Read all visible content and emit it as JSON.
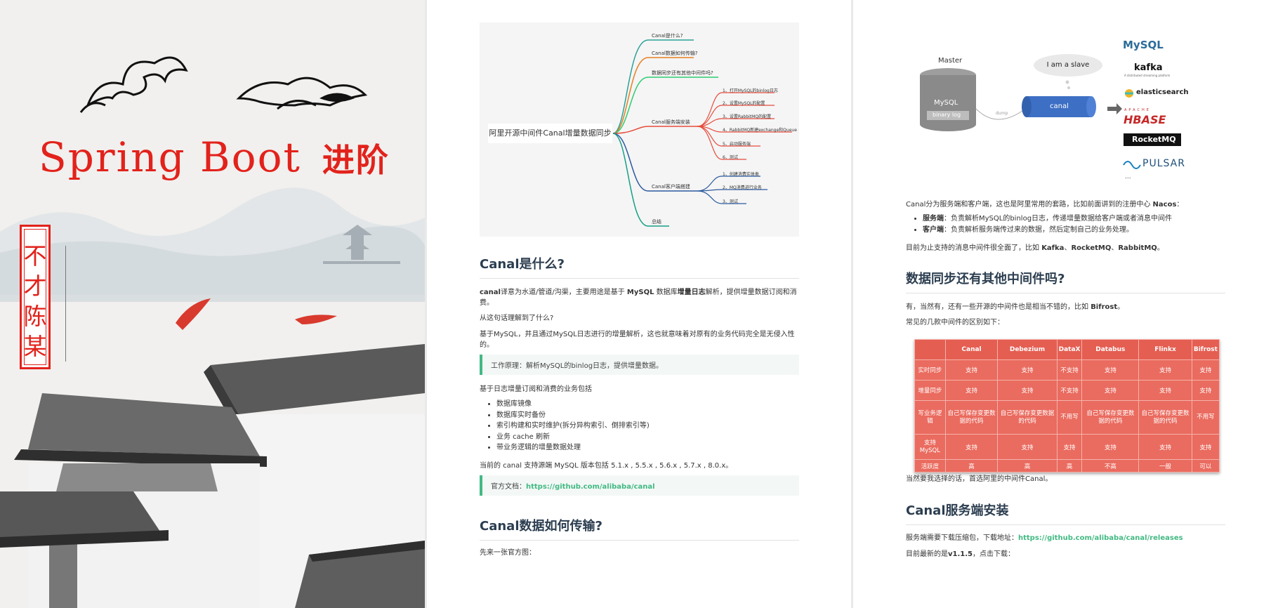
{
  "cover": {
    "title": "Spring Boot",
    "title_suffix": "进阶",
    "seal_text": [
      "不",
      "才",
      "陈",
      "某"
    ]
  },
  "page2": {
    "mindmap": {
      "root": "阿里开源中间件Canal增量数据同步",
      "branches": [
        {
          "label": "Canal是什么?",
          "color": "#2aa198",
          "children": []
        },
        {
          "label": "Canal数据如何传输?",
          "color": "#e67e22",
          "children": []
        },
        {
          "label": "数据同步还有其他中间件吗?",
          "color": "#2ecc71",
          "children": []
        },
        {
          "label": "Canal服务端安装",
          "color": "#e74c3c",
          "children": [
            "1、打开MySQL的binlog日志",
            "2、设置MySQL的配置",
            "3、设置RabbitMQ的配置",
            "4、RabbitMQ新建exchange和Queue",
            "5、启动服务端",
            "6、测试"
          ]
        },
        {
          "label": "Canal客户端搭建",
          "color": "#2c5aa0",
          "children": [
            "1、创建消费实体类",
            "2、MQ消费进行业务",
            "3、测试"
          ]
        },
        {
          "label": "总结",
          "color": "#16a085",
          "children": []
        }
      ]
    },
    "sec1_title": "Canal是什么?",
    "sec1_p1_a": "canal",
    "sec1_p1_b": "译意为水道/管道/沟渠，主要用途是基于 ",
    "sec1_p1_c": "MySQL",
    "sec1_p1_d": " 数据库",
    "sec1_p1_e": "增量日志",
    "sec1_p1_f": "解析，提供增量数据订阅和消",
    "sec1_p1_g": "费。",
    "sec1_p2": "从这句话理解到了什么?",
    "sec1_p3a": "基于MySQL，并且通过MySQL日志进行的增量解析，这也就意味着对原有的业务代码完全是无侵入性",
    "sec1_p3b": "的。",
    "callout1": "工作原理：解析MySQL的binlog日志，提供增量数据。",
    "sec1_p4": "基于日志增量订阅和消费的业务包括",
    "bullets": [
      "数据库镜像",
      "数据库实时备份",
      "索引构建和实时维护(拆分异构索引、倒排索引等)",
      "业务 cache 刷新",
      "带业务逻辑的增量数据处理"
    ],
    "sec1_p5": "当前的 canal 支持源端 MySQL 版本包括 5.1.x , 5.5.x , 5.6.x , 5.7.x , 8.0.x。",
    "callout2_label": "官方文档：",
    "callout2_link": "https://github.com/alibaba/canal",
    "sec2_title": "Canal数据如何传输?",
    "sec2_p1": "先来一张官方图："
  },
  "page3": {
    "arch": {
      "master": "Master",
      "mysql": "MySQL",
      "binlog": "binary log",
      "dump": "dump",
      "slave_bubble": "I am a slave",
      "canal": "canal",
      "logos": [
        "MySQL",
        "kafka",
        "elasticsearch",
        "HBASE",
        "RocketMQ",
        "PULSAR",
        "..."
      ],
      "kafka_sub": "A distributed streaming platform",
      "hbase_sub": "APACHE"
    },
    "p1_a": "Canal分为服务端和客户端，这也是阿里常用的套路，比如前面讲到的注册中心 ",
    "p1_b": "Nacos",
    "p1_c": "：",
    "b1_strong": "服务端",
    "b1_text": "：负责解析MySQL的binlog日志，传递增量数据给客户端或者消息中间件",
    "b2_strong": "客户端",
    "b2_text": "：负责解析服务端传过来的数据，然后定制自己的业务处理。",
    "p2_a": "目前为止支持的消息中间件很全面了，比如 ",
    "p2_k": "Kafka",
    "p2_sep1": "、",
    "p2_r": "RocketMQ",
    "p2_sep2": "、",
    "p2_rb": "RabbitMQ",
    "p2_end": "。",
    "sec3_title": "数据同步还有其他中间件吗?",
    "p3_a": "有，当然有，还有一些开源的中间件也是相当不错的，比如 ",
    "p3_b": "Bifrost",
    "p3_c": "。",
    "p4": "常见的几款中间件的区别如下：",
    "table": {
      "headers": [
        "",
        "Canal",
        "Debezium",
        "DataX",
        "Databus",
        "Flinkx",
        "Bifrost"
      ],
      "rows": [
        [
          "实时同步",
          "支持",
          "支持",
          "不支持",
          "支持",
          "支持",
          "支持"
        ],
        [
          "增量同步",
          "支持",
          "支持",
          "不支持",
          "支持",
          "支持",
          "支持"
        ],
        [
          "写业务逻辑",
          "自己写保存变更数据的代码",
          "自己写保存变更数据的代码",
          "不用写",
          "自己写保存变更数据的代码",
          "自己写保存变更数据的代码",
          "不用写"
        ],
        [
          "支持MySQL",
          "支持",
          "支持",
          "支持",
          "支持",
          "支持",
          "支持"
        ],
        [
          "活跃度",
          "高",
          "高",
          "高",
          "不高",
          "一般",
          "可以"
        ]
      ]
    },
    "p5": "当然要我选择的话，首选阿里的中间件Canal。",
    "sec4_title": "Canal服务端安装",
    "p6_a": "服务端需要下载压缩包，下载地址：",
    "p6_link": "https://github.com/alibaba/canal/releases",
    "p7_a": "目前最新的是",
    "p7_b": "v1.1.5",
    "p7_c": "，点击下载："
  }
}
